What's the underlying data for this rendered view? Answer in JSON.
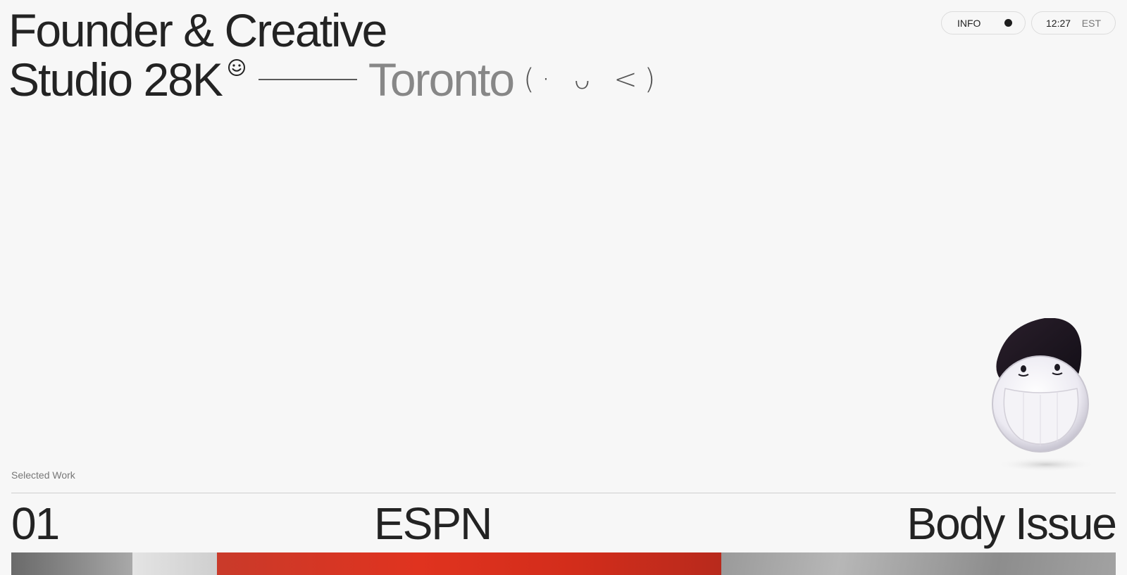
{
  "headline": {
    "line1": "Founder & Creative",
    "line2": "Studio 28K",
    "smiley_glyph": "☺",
    "city": "Toronto",
    "emoticon": "(·  ᴗ  <)"
  },
  "header": {
    "info_label": "INFO",
    "time": "12:27",
    "timezone": "EST"
  },
  "work": {
    "section_label": "Selected Work",
    "items": [
      {
        "number": "01",
        "client": "ESPN",
        "title": "Body Issue"
      }
    ]
  },
  "colors": {
    "background": "#f7f7f7",
    "text": "#232323",
    "muted": "#878787",
    "accent_red": "#e0331f"
  },
  "icons": {
    "smiley": "smiley-icon",
    "status_dot": "dot-icon",
    "mascot": "mascot-illustration"
  }
}
